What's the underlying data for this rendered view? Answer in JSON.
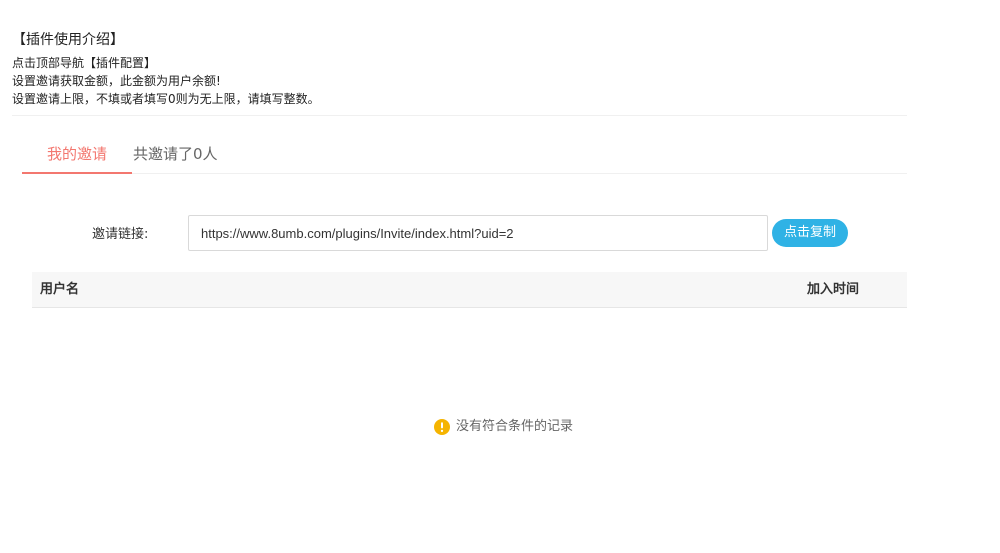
{
  "intro": {
    "title": "【插件使用介绍】",
    "lines": [
      "点击顶部导航【插件配置】",
      "设置邀请获取金额，此金额为用户余额!",
      "设置邀请上限，不填或者填写0则为无上限，请填写整数。"
    ]
  },
  "tabs": {
    "active_label": "我的邀请",
    "count_label": "共邀请了0人"
  },
  "invite": {
    "label": "邀请链接:",
    "link_value": "https://www.8umb.com/plugins/Invite/index.html?uid=2",
    "copy_button_label": "点击复制"
  },
  "table": {
    "columns": [
      "用户名",
      "加入时间"
    ],
    "rows": [],
    "empty_message": "没有符合条件的记录"
  },
  "colors": {
    "active_tab": "#f3776f",
    "copy_button": "#2fb2e5",
    "warning_icon": "#f5b400"
  },
  "icons": {
    "empty_state": "warning-circle-icon"
  }
}
